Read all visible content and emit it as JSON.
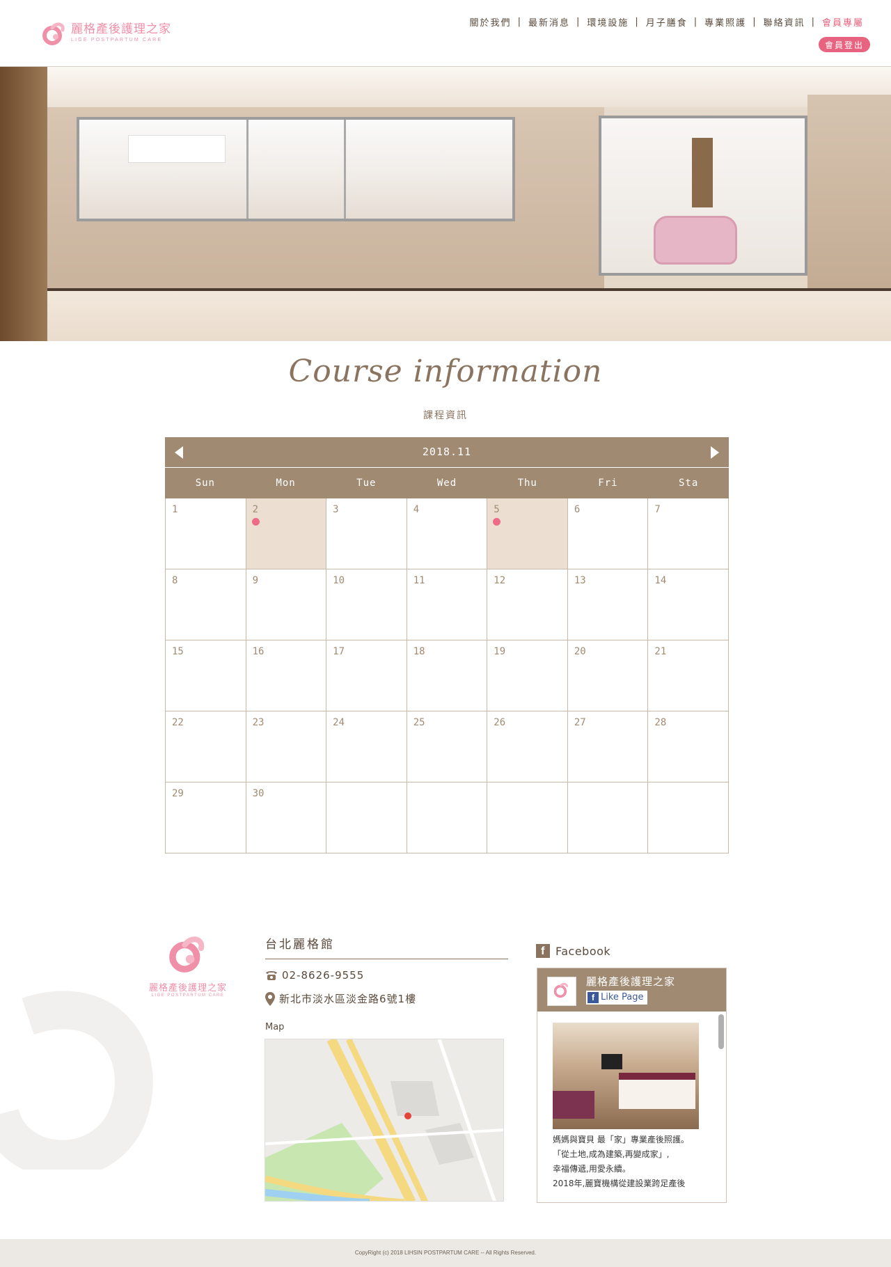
{
  "brand": {
    "name_cn": "麗格產後護理之家",
    "name_en": "LIGE POSTPARTUM CARE",
    "color": "#ef8fa8"
  },
  "nav": {
    "items": [
      "關於我們",
      "最新消息",
      "環境設施",
      "月子膳食",
      "專業照護",
      "聯絡資訊",
      "會員專屬"
    ],
    "logout": "會員登出"
  },
  "page": {
    "title_script": "Course information",
    "title_cn": "課程資訊"
  },
  "calendar": {
    "month": "2018.11",
    "weekdays": [
      "Sun",
      "Mon",
      "Tue",
      "Wed",
      "Thu",
      "Fri",
      "Sta"
    ],
    "first_weekday_index": 0,
    "days_in_month": 30,
    "event_days": [
      2,
      5
    ],
    "event_color": "#ee6c87",
    "header_color": "#a08b72"
  },
  "footer": {
    "branch_name": "台北麗格館",
    "phone": "02-8626-9555",
    "address": "新北市淡水區淡金路6號1樓",
    "map_label": "Map",
    "facebook_label": "Facebook",
    "fb_page_name": "麗格產後護理之家",
    "fb_like": "Like Page",
    "fb_post": [
      "媽媽與寶貝 最「家」專業產後照護。",
      "「從土地,成為建築,再變成家」,",
      "幸福傳遞,用愛永續。",
      "2018年,麗寶機構從建設業跨足產後"
    ],
    "copyright": "CopyRight (c) 2018   LIHSIN POSTPARTUM CARE -- All Rights Reserved."
  }
}
